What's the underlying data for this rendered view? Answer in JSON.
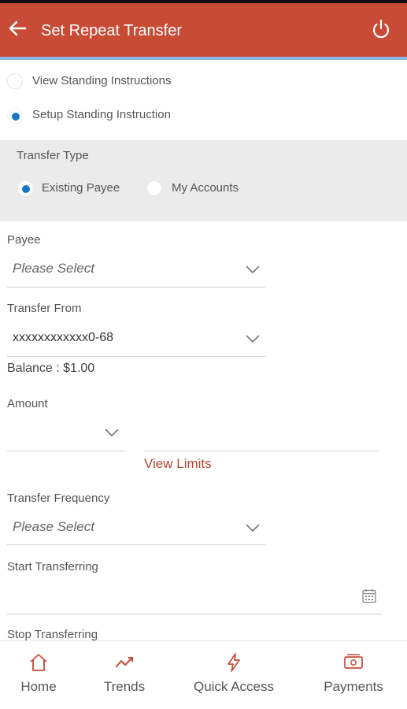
{
  "header": {
    "title": "Set Repeat Transfer",
    "back_icon": "arrow-left-icon",
    "power_icon": "power-icon"
  },
  "mode_options": [
    {
      "label": "View Standing Instructions",
      "selected": false
    },
    {
      "label": "Setup Standing Instruction",
      "selected": true
    }
  ],
  "transfer_type": {
    "title": "Transfer Type",
    "options": [
      {
        "label": "Existing Payee",
        "selected": true
      },
      {
        "label": "My Accounts",
        "selected": false
      }
    ]
  },
  "form": {
    "payee": {
      "label": "Payee",
      "value": "Please Select"
    },
    "transfer_from": {
      "label": "Transfer From",
      "value": "xxxxxxxxxxxx0-68",
      "balance": "Balance : $1.00"
    },
    "amount": {
      "label": "Amount",
      "currency_value": "",
      "amount_value": ""
    },
    "view_limits": "View Limits",
    "frequency": {
      "label": "Transfer Frequency",
      "value": "Please Select"
    },
    "start": {
      "label": "Start Transferring",
      "value": ""
    },
    "stop": {
      "label": "Stop Transferring"
    }
  },
  "bottom_nav": [
    {
      "label": "Home",
      "icon": "home-icon"
    },
    {
      "label": "Trends",
      "icon": "trends-icon"
    },
    {
      "label": "Quick Access",
      "icon": "lightning-icon"
    },
    {
      "label": "Payments",
      "icon": "payments-icon"
    }
  ],
  "colors": {
    "header": "#c84b36",
    "accent_blue": "#1777c9",
    "link": "#b5452f",
    "panel_bg": "#ebebeb"
  }
}
